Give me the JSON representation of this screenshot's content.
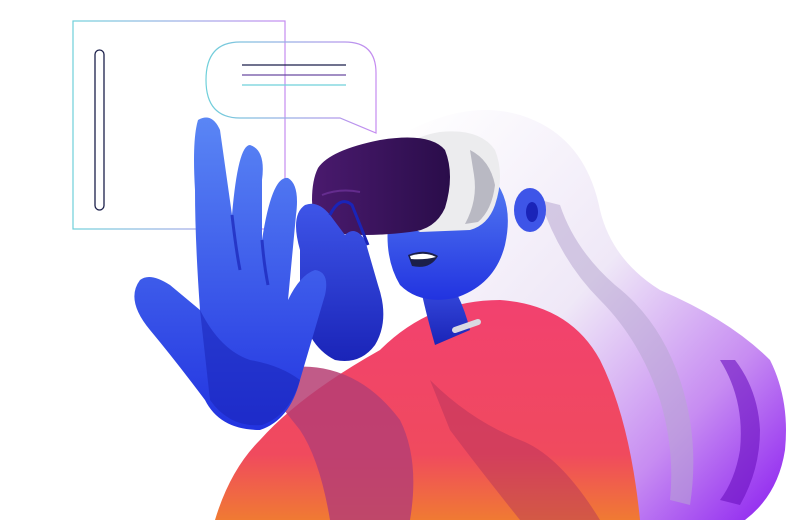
{
  "illustration": {
    "subject": "woman-wearing-vr-headset",
    "colors": {
      "background": "#ffffff",
      "skin_blue": "#3b4ef0",
      "skin_blue_dark": "#1a24b8",
      "skin_light": "#5a86f5",
      "headset_white": "#ececee",
      "headset_shade": "#b9b9c3",
      "visor_dark": "#2a0d4a",
      "visor_mid": "#4a1a6e",
      "hair_white": "#f3f0f8",
      "hair_purple": "#8a1cf0",
      "hair_shadow": "#b8a8d2",
      "shirt_pink": "#f03f6d",
      "shirt_orange": "#f07a33",
      "shirt_shadow": "#b0305c",
      "line_cyan": "#6fd0da",
      "line_purple": "#a13bf0",
      "line_navy": "#1b1f4a"
    },
    "icons": [
      "vr-headset-icon",
      "speech-bubble-icon",
      "hologram-panel-icon"
    ]
  }
}
